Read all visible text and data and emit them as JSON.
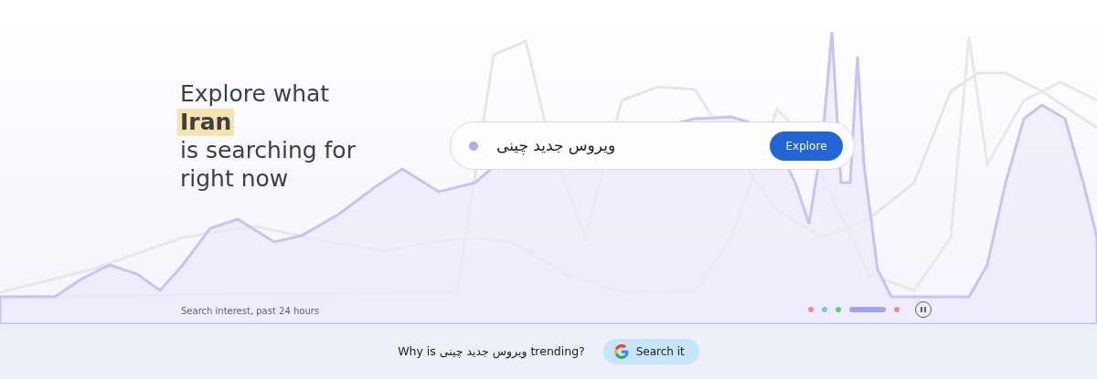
{
  "headline": {
    "lines": [
      {
        "text": "Explore what",
        "highlight": false
      },
      {
        "text": "Iran",
        "highlight": true
      },
      {
        "text": "is searching for",
        "highlight": false
      },
      {
        "text": "right now",
        "highlight": false
      }
    ]
  },
  "search": {
    "value": "ویروس جدید چینی",
    "button": "Explore"
  },
  "caption": "Search interest, past 24 hours",
  "carousel": {
    "dots": [
      {
        "color": "#f28b82",
        "selected": false
      },
      {
        "color": "#78c3fb",
        "selected": false
      },
      {
        "color": "#5bd27a",
        "selected": false
      },
      {
        "color": "#a8a0f0",
        "selected": true
      },
      {
        "color": "#f28b82",
        "selected": false
      }
    ]
  },
  "footer": {
    "question": "Why is ویروس جدید چینی trending?",
    "button": "Search it"
  }
}
